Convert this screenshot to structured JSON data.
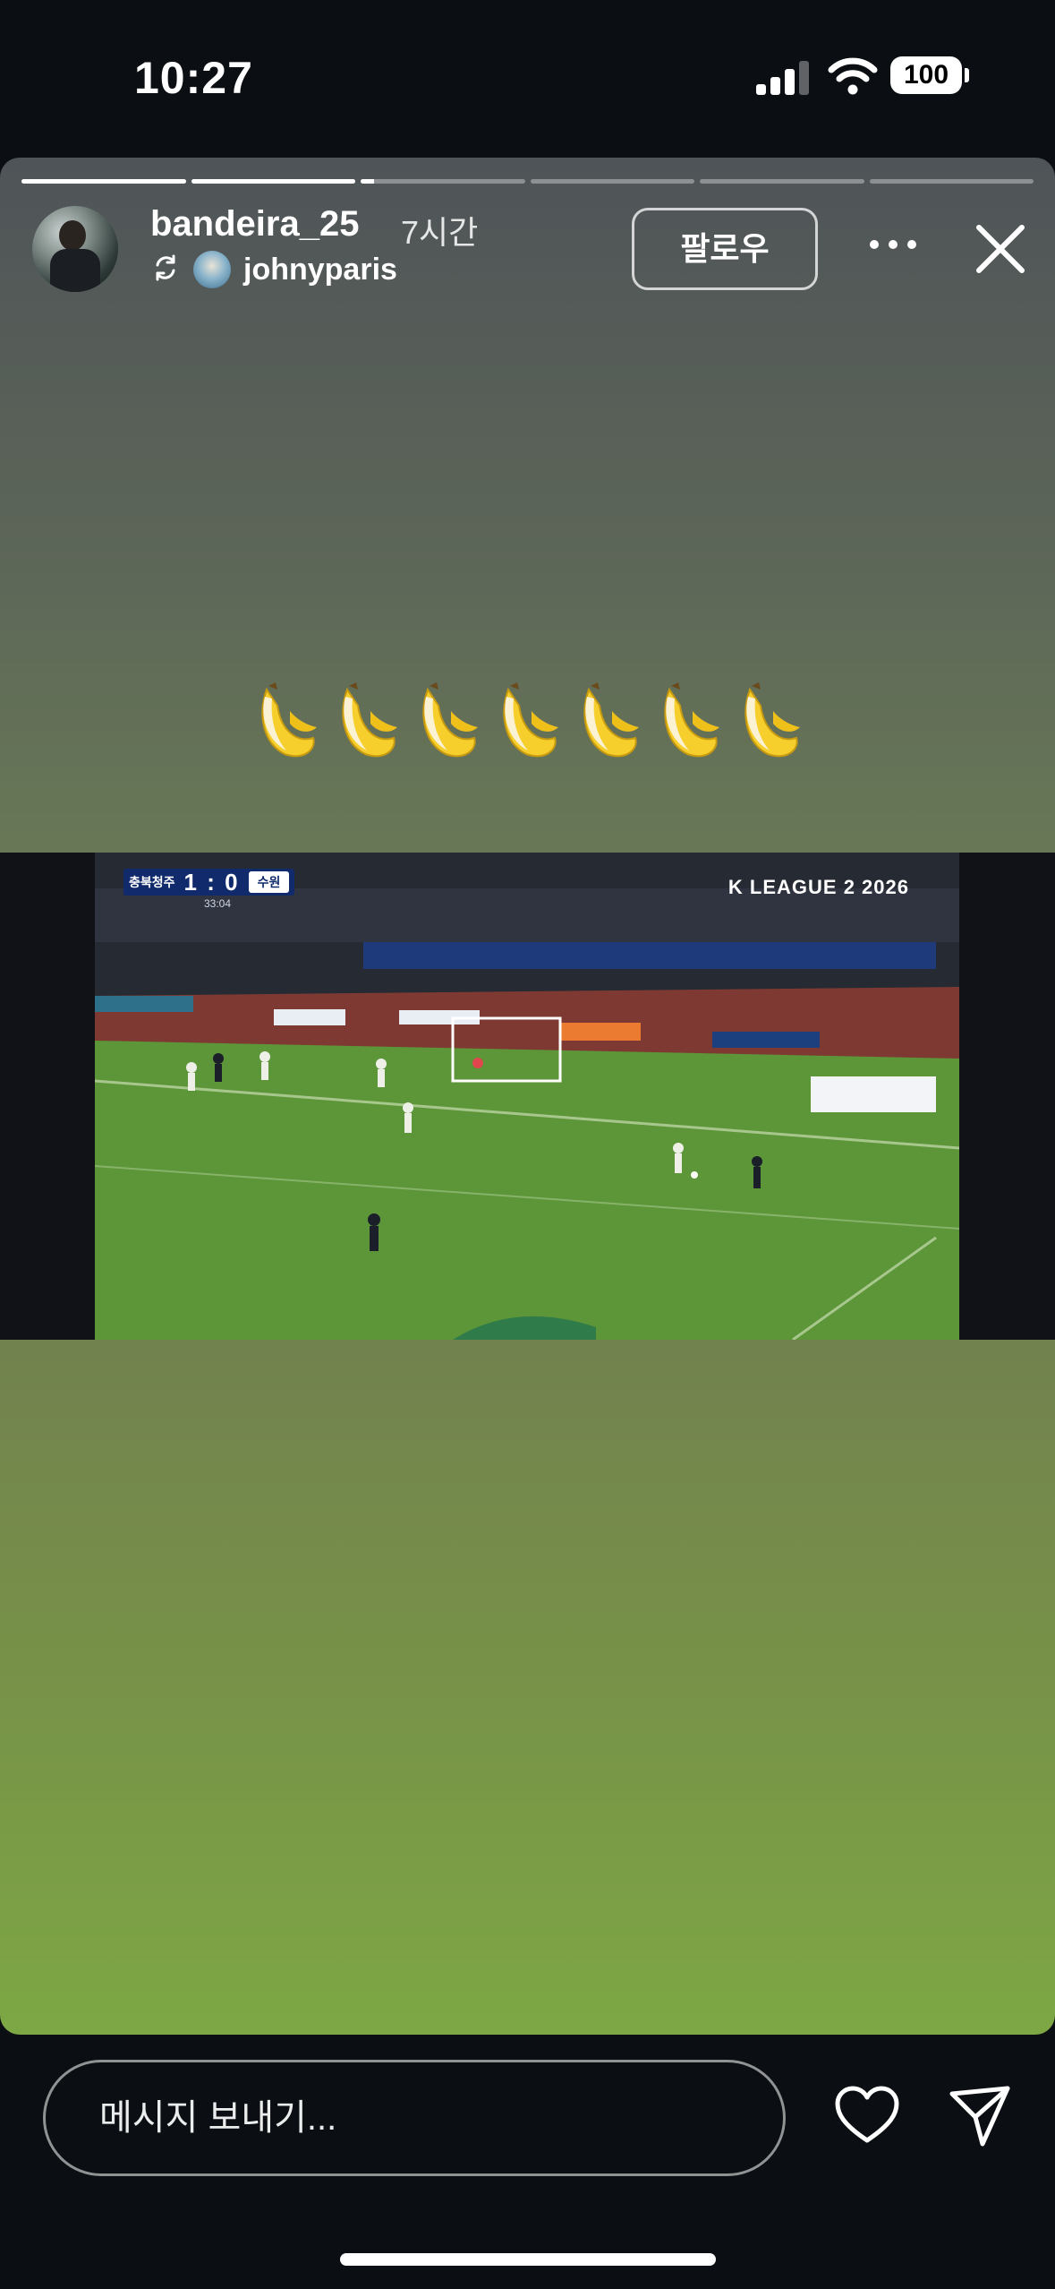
{
  "status_bar": {
    "time": "10:27",
    "battery": "100",
    "icons": [
      "signal-icon",
      "wifi-icon",
      "battery-icon"
    ]
  },
  "story": {
    "segments_total": 6,
    "segments_viewed": 2,
    "current_progress": 0.08,
    "username": "bandeira_25",
    "time_ago": "7시간",
    "repost_username": "johnyparis",
    "follow_label": "팔로우",
    "caption_emoji": "🍌🍌🍌🍌🍌🍌🍌",
    "video": {
      "home_team": "충북청주",
      "score": "1 : 0",
      "away_team": "수원",
      "clock": "33:04",
      "league": "K LEAGUE 2 2026"
    }
  },
  "reply": {
    "placeholder": "메시지 보내기..."
  },
  "colors": {
    "background": "#0b0e13",
    "story_top": "#4f5458",
    "story_bottom": "#7da744",
    "pitch": "#5f9a3a"
  }
}
